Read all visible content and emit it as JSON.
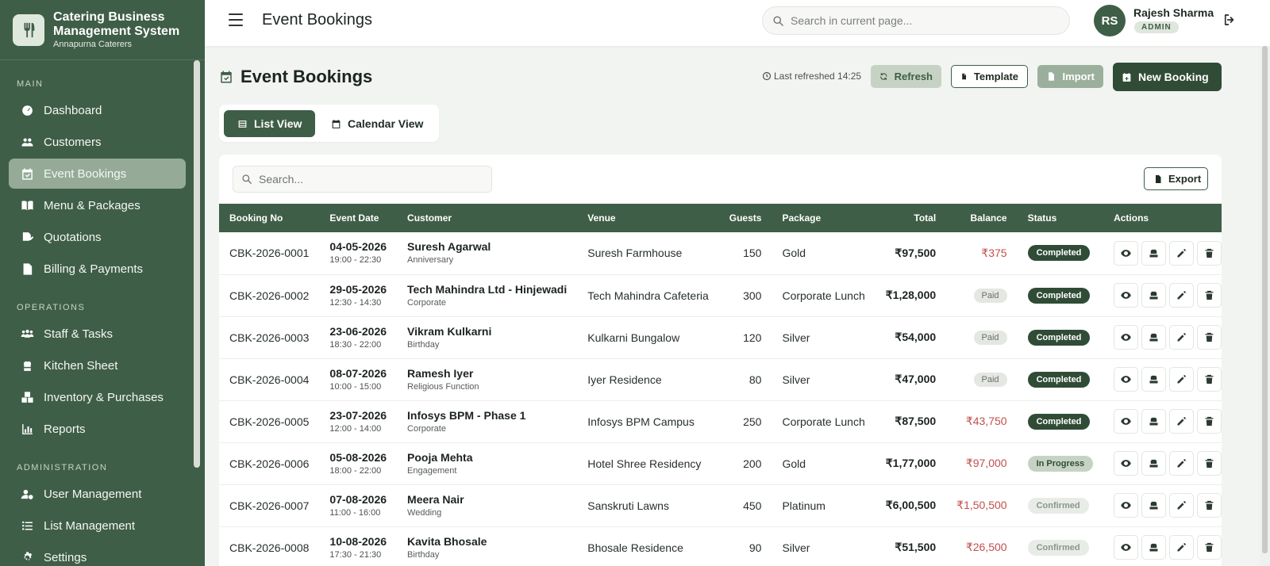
{
  "app": {
    "name": "Catering Business Management System",
    "tenant": "Annapurna Caterers"
  },
  "sidebar": {
    "sections": [
      {
        "title": "MAIN",
        "items": [
          {
            "label": "Dashboard",
            "icon": "dashboard-icon"
          },
          {
            "label": "Customers",
            "icon": "users-icon"
          },
          {
            "label": "Event Bookings",
            "icon": "calendar-check-icon",
            "active": true
          },
          {
            "label": "Menu & Packages",
            "icon": "book-icon"
          },
          {
            "label": "Quotations",
            "icon": "quote-icon"
          },
          {
            "label": "Billing & Payments",
            "icon": "invoice-icon"
          }
        ]
      },
      {
        "title": "OPERATIONS",
        "items": [
          {
            "label": "Staff & Tasks",
            "icon": "team-icon"
          },
          {
            "label": "Kitchen Sheet",
            "icon": "chef-icon"
          },
          {
            "label": "Inventory & Purchases",
            "icon": "boxes-icon"
          },
          {
            "label": "Reports",
            "icon": "chart-icon"
          }
        ]
      },
      {
        "title": "ADMINISTRATION",
        "items": [
          {
            "label": "User Management",
            "icon": "user-cog-icon"
          },
          {
            "label": "List Management",
            "icon": "list-icon"
          },
          {
            "label": "Settings",
            "icon": "gear-icon"
          }
        ]
      }
    ]
  },
  "topbar": {
    "title": "Event Bookings",
    "search_placeholder": "Search in current page...",
    "user": {
      "initials": "RS",
      "name": "Rajesh Sharma",
      "role": "ADMIN"
    }
  },
  "page": {
    "title": "Event Bookings",
    "last_refreshed": "Last refreshed 14:25",
    "buttons": {
      "refresh": "Refresh",
      "template": "Template",
      "import": "Import",
      "new_booking": "New Booking"
    },
    "tabs": {
      "list": "List View",
      "calendar": "Calendar View"
    },
    "table_search_placeholder": "Search...",
    "export": "Export"
  },
  "table": {
    "headers": {
      "booking_no": "Booking No",
      "event_date": "Event Date",
      "customer": "Customer",
      "venue": "Venue",
      "guests": "Guests",
      "package": "Package",
      "total": "Total",
      "balance": "Balance",
      "status": "Status",
      "actions": "Actions"
    },
    "rows": [
      {
        "no": "CBK-2026-0001",
        "date": "04-05-2026",
        "time": "19:00 - 22:30",
        "customer": "Suresh Agarwal",
        "type": "Anniversary",
        "venue": "Suresh Farmhouse",
        "guests": "150",
        "package": "Gold",
        "total": "₹97,500",
        "balance": "₹375",
        "paid": false,
        "status": "Completed"
      },
      {
        "no": "CBK-2026-0002",
        "date": "29-05-2026",
        "time": "12:30 - 14:30",
        "customer": "Tech Mahindra Ltd - Hinjewadi",
        "type": "Corporate",
        "venue": "Tech Mahindra Cafeteria",
        "guests": "300",
        "package": "Corporate Lunch",
        "total": "₹1,28,000",
        "balance": "Paid",
        "paid": true,
        "status": "Completed"
      },
      {
        "no": "CBK-2026-0003",
        "date": "23-06-2026",
        "time": "18:30 - 22:00",
        "customer": "Vikram Kulkarni",
        "type": "Birthday",
        "venue": "Kulkarni Bungalow",
        "guests": "120",
        "package": "Silver",
        "total": "₹54,000",
        "balance": "Paid",
        "paid": true,
        "status": "Completed"
      },
      {
        "no": "CBK-2026-0004",
        "date": "08-07-2026",
        "time": "10:00 - 15:00",
        "customer": "Ramesh Iyer",
        "type": "Religious Function",
        "venue": "Iyer Residence",
        "guests": "80",
        "package": "Silver",
        "total": "₹47,000",
        "balance": "Paid",
        "paid": true,
        "status": "Completed"
      },
      {
        "no": "CBK-2026-0005",
        "date": "23-07-2026",
        "time": "12:00 - 14:00",
        "customer": "Infosys BPM - Phase 1",
        "type": "Corporate",
        "venue": "Infosys BPM Campus",
        "guests": "250",
        "package": "Corporate Lunch",
        "total": "₹87,500",
        "balance": "₹43,750",
        "paid": false,
        "status": "Completed"
      },
      {
        "no": "CBK-2026-0006",
        "date": "05-08-2026",
        "time": "18:00 - 22:00",
        "customer": "Pooja Mehta",
        "type": "Engagement",
        "venue": "Hotel Shree Residency",
        "guests": "200",
        "package": "Gold",
        "total": "₹1,77,000",
        "balance": "₹97,000",
        "paid": false,
        "status": "In Progress"
      },
      {
        "no": "CBK-2026-0007",
        "date": "07-08-2026",
        "time": "11:00 - 16:00",
        "customer": "Meera Nair",
        "type": "Wedding",
        "venue": "Sanskruti Lawns",
        "guests": "450",
        "package": "Platinum",
        "total": "₹6,00,500",
        "balance": "₹1,50,500",
        "paid": false,
        "status": "Confirmed"
      },
      {
        "no": "CBK-2026-0008",
        "date": "10-08-2026",
        "time": "17:30 - 21:30",
        "customer": "Kavita Bhosale",
        "type": "Birthday",
        "venue": "Bhosale Residence",
        "guests": "90",
        "package": "Silver",
        "total": "₹51,500",
        "balance": "₹26,500",
        "paid": false,
        "status": "Confirmed"
      }
    ]
  },
  "colors": {
    "sidebar": "#3f5e47",
    "active_item": "#95ab97",
    "accent_dark": "#304c37",
    "due": "#c0504d"
  }
}
